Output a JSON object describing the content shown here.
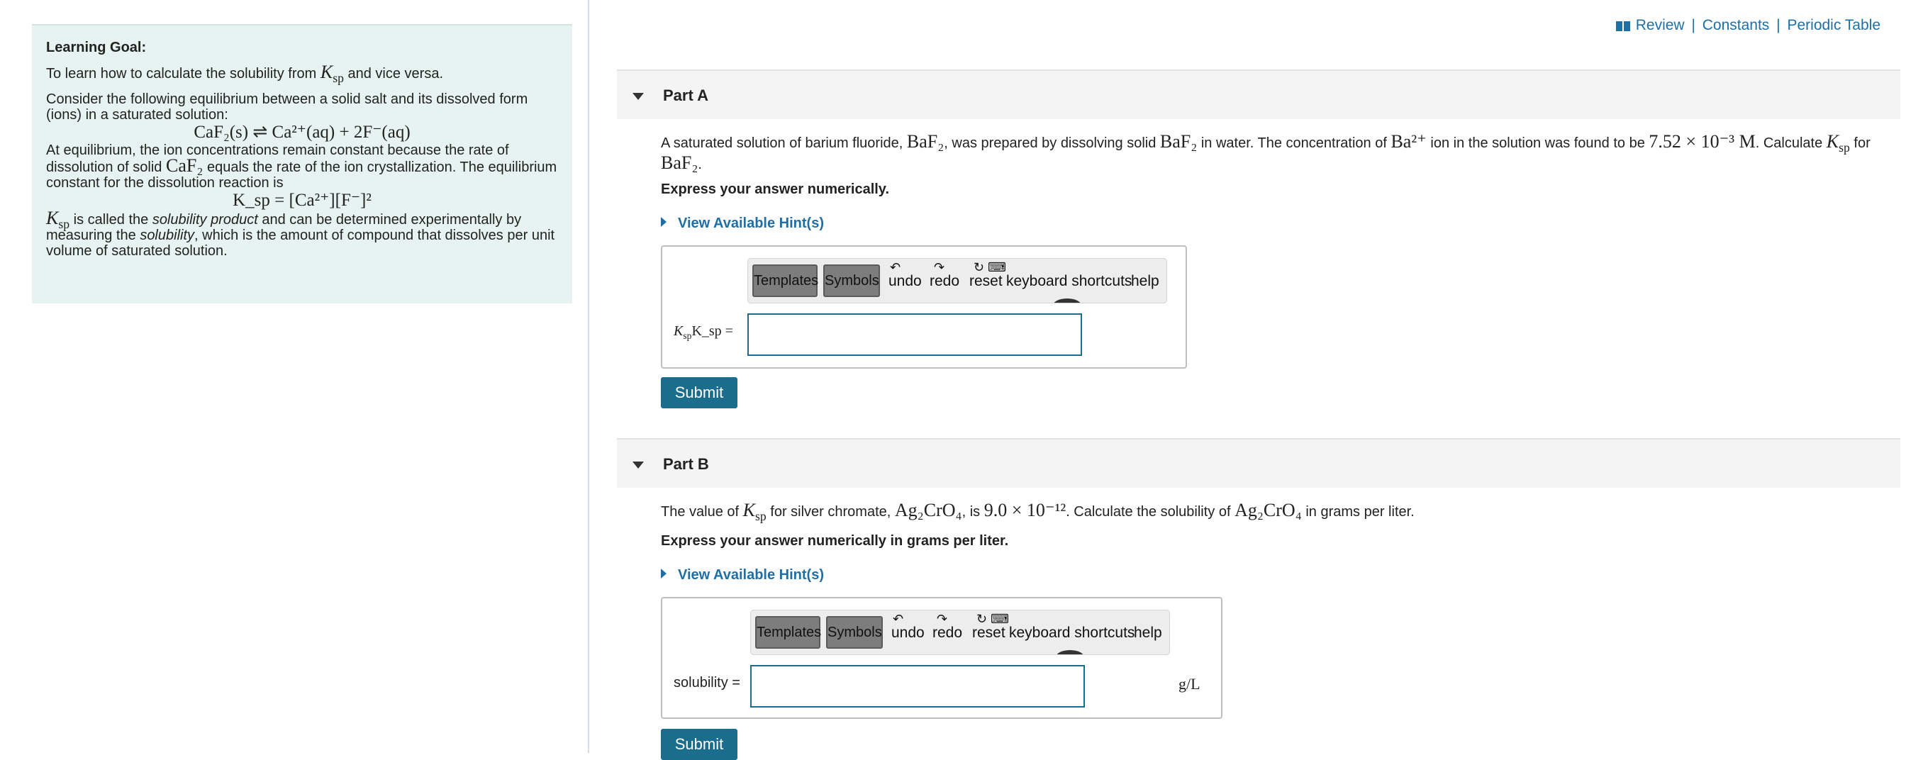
{
  "top_links": {
    "review": "Review",
    "constants": "Constants",
    "periodic_table": "Periodic Table",
    "separator": "|"
  },
  "left": {
    "title": "Learning Goal:",
    "goal_prefix": "To learn how to calculate the solubility from",
    "goal_ksp": "K",
    "goal_ksp_sub": "sp",
    "goal_suffix": "and vice versa.",
    "consider": "Consider the following equilibrium between a solid salt and its dissolved form (ions) in a saturated solution:",
    "equilibrium_eq": "CaF₂(s) ⇌ Ca²⁺(aq) + 2F⁻(aq)",
    "eq_text_1": "At equilibrium, the ion concentrations remain constant because the rate of dissolution of solid",
    "eq_text_caf2": "CaF₂",
    "eq_text_2": "equals the rate of the ion crystallization. The equilibrium constant for the dissolution reaction is",
    "ksp_expression": "K_sp = [Ca²⁺][F⁻]²",
    "ksp_sym": "K",
    "ksp_sub": "sp",
    "ksp_text_1": "is called the",
    "ksp_term": "solubility product",
    "ksp_text_2": "and can be determined experimentally by measuring the",
    "solubility_term": "solubility",
    "ksp_text_3": ", which is the amount of compound that dissolves per unit volume of saturated solution."
  },
  "toolbar": {
    "templates": "Templates",
    "symbols": "Symbols",
    "undo": "undo",
    "redo": "redo",
    "reset": "reset",
    "shortcuts": "keyboard shortcuts",
    "help": "help"
  },
  "part_a": {
    "title": "Part A",
    "q1": "A saturated solution of barium fluoride,",
    "baf2": "BaF₂",
    "q2": ", was prepared by dissolving solid",
    "q3": "in water. The concentration of",
    "ba_ion": "Ba²⁺",
    "q4": "ion in the solution was found to be",
    "concentration": "7.52 × 10⁻³ M",
    "q5": ". Calculate",
    "q6": "for",
    "q7": ".",
    "instruction": "Express your answer numerically.",
    "hint": "View Available Hint(s)",
    "label_k": "K",
    "label_sub": "sp",
    "label_text": "K_sp =",
    "input_value": "",
    "submit": "Submit"
  },
  "part_b": {
    "title": "Part B",
    "q1": "The value of",
    "q2": "for silver chromate,",
    "compound": "Ag₂CrO₄",
    "q3": ", is",
    "ksp_value": "9.0 × 10⁻¹²",
    "q4": ". Calculate the solubility of",
    "q5": "in grams per liter.",
    "instruction": "Express your answer numerically in grams per liter.",
    "hint": "View Available Hint(s)",
    "label": "solubility =",
    "input_value": "",
    "unit": "g/L",
    "submit": "Submit"
  }
}
